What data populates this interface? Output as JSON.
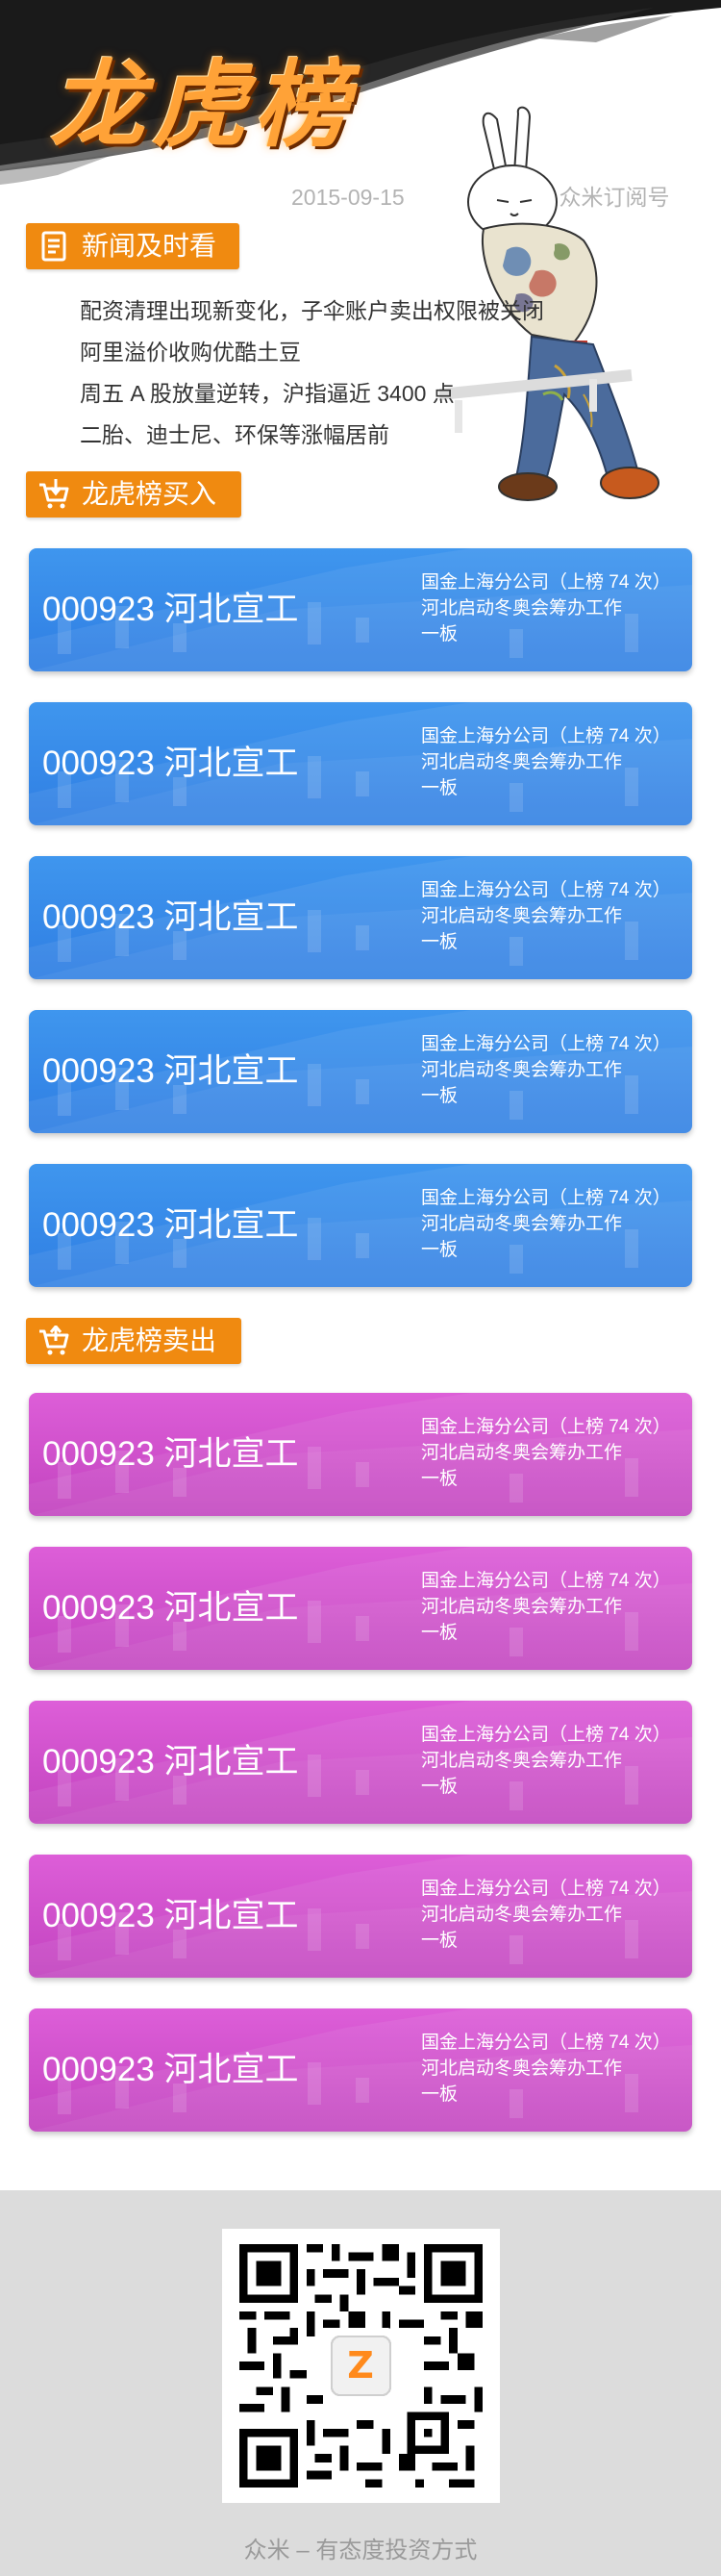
{
  "header": {
    "title": "龙虎榜",
    "date": "2015-09-15",
    "account": "公众号：众米订阅号"
  },
  "sections": {
    "news_label": "新闻及时看",
    "buy_label": "龙虎榜买入",
    "sell_label": "龙虎榜卖出"
  },
  "news": [
    "配资清理出现新变化，子伞账户卖出权限被关闭",
    "阿里溢价收购优酷土豆",
    "周五 A 股放量逆转，沪指逼近 3400 点",
    "二胎、迪士尼、环保等涨幅居前"
  ],
  "buy_list": [
    {
      "stock": "000923 河北宣工",
      "broker": "国金上海分公司（上榜 74 次）",
      "reason": "河北启动冬奥会筹办工作",
      "board": "一板"
    },
    {
      "stock": "000923 河北宣工",
      "broker": "国金上海分公司（上榜 74 次）",
      "reason": "河北启动冬奥会筹办工作",
      "board": "一板"
    },
    {
      "stock": "000923 河北宣工",
      "broker": "国金上海分公司（上榜 74 次）",
      "reason": "河北启动冬奥会筹办工作",
      "board": "一板"
    },
    {
      "stock": "000923 河北宣工",
      "broker": "国金上海分公司（上榜 74 次）",
      "reason": "河北启动冬奥会筹办工作",
      "board": "一板"
    },
    {
      "stock": "000923 河北宣工",
      "broker": "国金上海分公司（上榜 74 次）",
      "reason": "河北启动冬奥会筹办工作",
      "board": "一板"
    }
  ],
  "sell_list": [
    {
      "stock": "000923 河北宣工",
      "broker": "国金上海分公司（上榜 74 次）",
      "reason": "河北启动冬奥会筹办工作",
      "board": "一板"
    },
    {
      "stock": "000923 河北宣工",
      "broker": "国金上海分公司（上榜 74 次）",
      "reason": "河北启动冬奥会筹办工作",
      "board": "一板"
    },
    {
      "stock": "000923 河北宣工",
      "broker": "国金上海分公司（上榜 74 次）",
      "reason": "河北启动冬奥会筹办工作",
      "board": "一板"
    },
    {
      "stock": "000923 河北宣工",
      "broker": "国金上海分公司（上榜 74 次）",
      "reason": "河北启动冬奥会筹办工作",
      "board": "一板"
    },
    {
      "stock": "000923 河北宣工",
      "broker": "国金上海分公司（上榜 74 次）",
      "reason": "河北启动冬奥会筹办工作",
      "board": "一板"
    }
  ],
  "footer": {
    "slogan": "众米 – 有态度投资方式",
    "qr_logo": "Z"
  },
  "colors": {
    "accent_orange": "#f08a10",
    "buy_blue": "#3a8ceb",
    "sell_magenta": "#d052cc"
  },
  "icons": {
    "news": "document-list-icon",
    "buy": "cart-down-arrow-icon",
    "sell": "cart-up-arrow-icon"
  }
}
